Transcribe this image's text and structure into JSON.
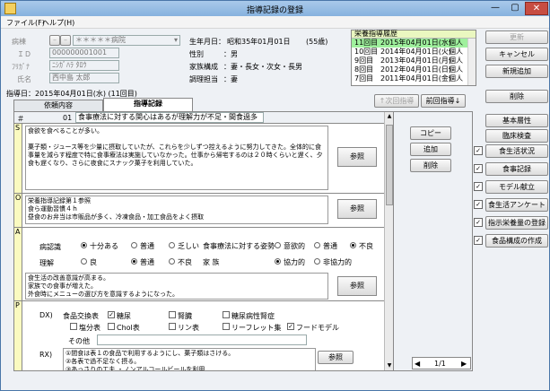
{
  "window": {
    "title": "指導記録の登録",
    "min": "—",
    "max": "▢",
    "close": "✕"
  },
  "menu": {
    "file": "ファイル(F)",
    "help": "ヘルプ(H)"
  },
  "patient": {
    "ward_label": "病棟",
    "ward_value": "＊＊＊＊＊病院",
    "id_label": "ＩＤ",
    "id_value": "000000001001",
    "kana_label": "ﾌﾘｶﾞﾅ",
    "kana_value": "ﾆｼｶﾞﾊﾗ ﾀﾛｳ",
    "name_label": "氏名",
    "name_value": "西中島 太郎",
    "birth_label": "生年月日：",
    "birth_value": "昭和35年01月01日",
    "age_value": "(55歳)",
    "sex_label": "性別",
    "sex_value": "：男",
    "family_label": "家族構成",
    "family_value": "：妻・長女・次女・長男",
    "cook_label": "調理担当",
    "cook_value": "：妻"
  },
  "history": {
    "title": "栄養指導履歴",
    "rows": [
      {
        "num": "11回目",
        "date": "2015年04月01日(水)",
        "type": "個人"
      },
      {
        "num": "10回目",
        "date": "2014年04月01日(火)",
        "type": "個人"
      },
      {
        "num": "9回目",
        "date": "2013年04月01日(月)",
        "type": "個人"
      },
      {
        "num": "8回目",
        "date": "2012年04月01日(日)",
        "type": "個人"
      },
      {
        "num": "7回目",
        "date": "2011年04月01日(金)",
        "type": "個人"
      }
    ]
  },
  "top_buttons": {
    "update": "更新",
    "cancel": "キャンセル",
    "new": "新規追加",
    "delete": "削除"
  },
  "guidance_date": "指導日：2015年04月01日(水) (11回目)",
  "nav": {
    "prev": "↑次回指導",
    "next": "前回指導↓"
  },
  "tabs": {
    "request": "依頼内容",
    "record": "指導記録"
  },
  "record": {
    "num_header": "＃",
    "num_value": "01",
    "topic_value": "食事療法に対する関心はあるが理解力が不足・間食過多",
    "copy": "コピー",
    "add": "追加",
    "remove": "削除",
    "s_label": "S",
    "s_text": "食欲を食べることが多い。\n\n菓子類・ジュース等を少量に摂取していたが、これらを少しずつ控えるように努力してきた。全体的に食事量を減らす程度で特に食事療法は実施していなかった。仕事から帰宅するのは２０時くらいと遅く、夕食も遅くなり、さらに夜食にスナック菓子を利用していた。",
    "s_ref": "参照",
    "o_label": "O",
    "o_text": "栄養指導記録第１参照\n食ら運動習慣４ｈ\n昼食のお弁当は市販品が多く、冷凍食品・加工食品をよく摂取",
    "o_ref": "参照",
    "a_label": "A",
    "a_text": "食生活の改善意識が高まる。\n家族での食事が増えた。\n外食時にメニューの選び方を意識するようになった。",
    "a_ref": "参照",
    "cognition_label": "病認識",
    "cog_opts": [
      "十分ある",
      "普通",
      "乏しい"
    ],
    "understanding_label": "理解",
    "und_opts": [
      "良",
      "普通",
      "不良"
    ],
    "attitude_label": "食事療法に対する姿勢",
    "att_opts": [
      "意欲的",
      "普通",
      "不良"
    ],
    "family_label": "家 族",
    "fam_opts": [
      "協力的",
      "非協力的"
    ],
    "p_label": "P",
    "dx_label": "DX)",
    "exchange_label": "食品交換表",
    "check_mark": "✓",
    "dx_opts": [
      "糖尿",
      "腎臓",
      "糖尿病性腎症",
      "塩分表",
      "Chol表",
      "リン表",
      "リーフレット集",
      "フードモデル"
    ],
    "other_label": "その他",
    "rx_label": "RX)",
    "rx_text": "①間食は表１の食品で利用するようにし、菓子類はさける。\n②各表で過不足なく摂る。\n③あっさりの工夫 ・ノンアルコールビールを利用",
    "rx_ref": "参照"
  },
  "side_buttons": {
    "basic": "基本層性",
    "clinical": "臨床検査",
    "diet_status": "食生活状況",
    "meal_record": "食事記録",
    "model": "モデル献立",
    "questionnaire": "食生活アンケート",
    "instruction": "指示栄養量の登録",
    "composition": "食品構成の作成"
  },
  "pager": {
    "text": "1/1",
    "first": "◀",
    "last": "▶"
  }
}
